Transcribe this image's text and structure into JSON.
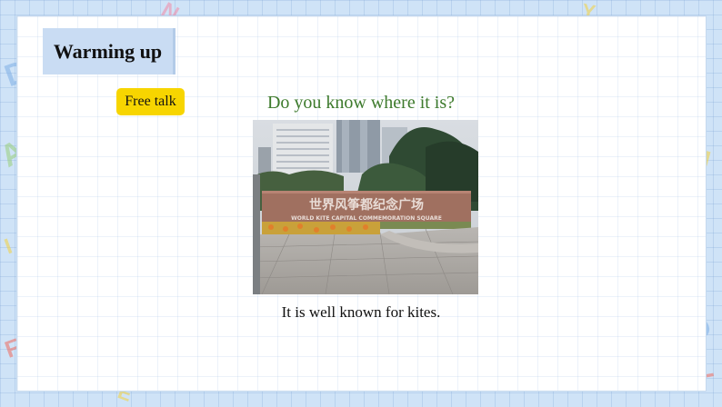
{
  "slide": {
    "title": "Warming up",
    "badge": "Free talk",
    "question": "Do you know where it is?",
    "caption": "It is well known for kites."
  },
  "photo": {
    "sign_cn": "世界风筝都纪念广场",
    "sign_en": "WORLD KITE CAPITAL COMMEMORATION SQUARE"
  },
  "colors": {
    "frame": "#cfe3f7",
    "title_box": "#c9dcf3",
    "badge": "#f7d500",
    "question": "#3d7a2c"
  }
}
